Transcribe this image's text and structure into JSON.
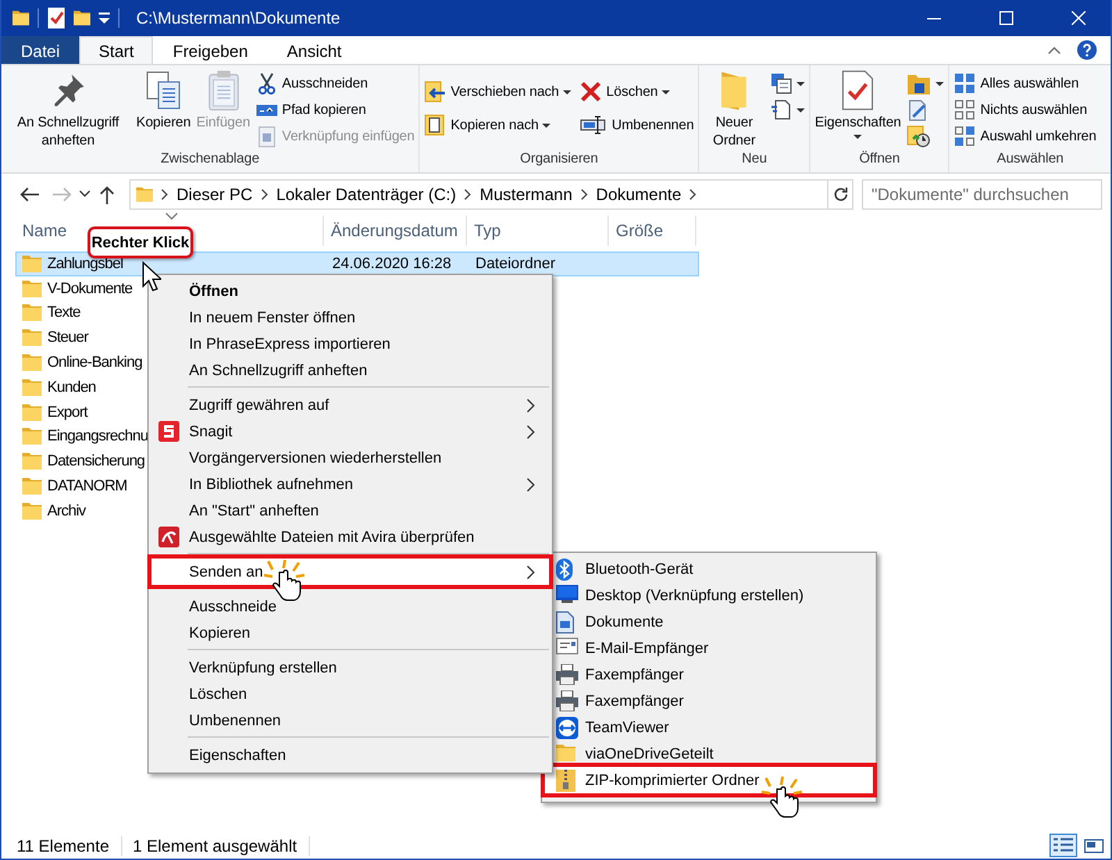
{
  "window": {
    "title": "C:\\Mustermann\\Dokumente"
  },
  "ribbon_tabs": [
    {
      "label": "Datei",
      "kind": "file",
      "selected": false
    },
    {
      "label": "Start",
      "kind": "tab",
      "selected": true
    },
    {
      "label": "Freigeben",
      "kind": "tab",
      "selected": false
    },
    {
      "label": "Ansicht",
      "kind": "tab",
      "selected": false
    }
  ],
  "ribbon_groups": [
    {
      "label": "Zwischenablage",
      "large": [
        {
          "label": "An Schnellzugriff anheften",
          "disabled": false,
          "dropdown": false
        },
        {
          "label": "Kopieren",
          "disabled": false,
          "dropdown": false
        },
        {
          "label": "Einfügen",
          "disabled": true,
          "dropdown": false
        }
      ],
      "small": [
        [
          {
            "kind": "text",
            "label": "Ausschneiden",
            "disabled": false,
            "dropdown": false
          },
          {
            "kind": "text",
            "label": "Pfad kopieren",
            "disabled": false,
            "dropdown": false
          },
          {
            "kind": "text",
            "label": "Verknüpfung einfügen",
            "disabled": true,
            "dropdown": false
          }
        ]
      ]
    },
    {
      "label": "Organisieren",
      "small": [
        [
          {
            "kind": "text",
            "label": "Verschieben nach",
            "disabled": false,
            "dropdown": true
          },
          {
            "kind": "text",
            "label": "Kopieren nach",
            "disabled": false,
            "dropdown": true
          }
        ],
        [
          {
            "kind": "text",
            "label": "Löschen",
            "disabled": false,
            "dropdown": true
          },
          {
            "kind": "text",
            "label": "Umbenennen",
            "disabled": false,
            "dropdown": false
          }
        ]
      ]
    },
    {
      "label": "Neu",
      "large": [
        {
          "label": "Neuer Ordner",
          "disabled": false,
          "dropdown": false
        }
      ],
      "small": [
        [
          {
            "kind": "icon",
            "disabled": false,
            "dropdown": true
          },
          {
            "kind": "icon",
            "disabled": false,
            "dropdown": true
          }
        ]
      ]
    },
    {
      "label": "Öffnen",
      "large": [
        {
          "label": "Eigenschaften",
          "disabled": false,
          "dropdown": true
        }
      ],
      "small": [
        [
          {
            "kind": "icon",
            "disabled": false,
            "dropdown": true
          },
          {
            "kind": "icon",
            "disabled": false,
            "dropdown": false
          },
          {
            "kind": "icon",
            "disabled": false,
            "dropdown": false
          }
        ]
      ]
    },
    {
      "label": "Auswählen",
      "small": [
        [
          {
            "kind": "text",
            "label": "Alles auswählen",
            "disabled": false,
            "dropdown": false
          },
          {
            "kind": "text",
            "label": "Nichts auswählen",
            "disabled": false,
            "dropdown": false
          },
          {
            "kind": "text",
            "label": "Auswahl umkehren",
            "disabled": false,
            "dropdown": false
          }
        ]
      ]
    }
  ],
  "breadcrumb": [
    "Dieser PC",
    "Lokaler Datenträger (C:)",
    "Mustermann",
    "Dokumente"
  ],
  "search": {
    "placeholder": "\"Dokumente\" durchsuchen"
  },
  "columns": [
    "Name",
    "Änderungsdatum",
    "Typ",
    "Größe"
  ],
  "rows": [
    {
      "name": "Zahlungsbel",
      "date": "24.06.2020 16:28",
      "type": "Dateiordner",
      "selected": true
    },
    {
      "name": "V-Dokumente",
      "selected": false
    },
    {
      "name": "Texte",
      "selected": false
    },
    {
      "name": "Steuer",
      "selected": false
    },
    {
      "name": "Online-Banking",
      "selected": false
    },
    {
      "name": "Kunden",
      "selected": false
    },
    {
      "name": "Export",
      "selected": false
    },
    {
      "name": "Eingangsrechnu",
      "selected": false
    },
    {
      "name": "Datensicherung",
      "selected": false
    },
    {
      "name": "DATANORM",
      "selected": false
    },
    {
      "name": "Archiv",
      "selected": false
    }
  ],
  "callout": "Rechter Klick",
  "context_menu": [
    {
      "kind": "default",
      "label": "Öffnen",
      "submenu": false,
      "selected": false
    },
    {
      "kind": "item",
      "label": "In neuem Fenster öffnen",
      "submenu": false,
      "selected": false
    },
    {
      "kind": "item",
      "label": "In PhraseExpress importieren",
      "submenu": false,
      "selected": false
    },
    {
      "kind": "item",
      "label": "An Schnellzugriff anheften",
      "submenu": false,
      "selected": false
    },
    {
      "kind": "separator"
    },
    {
      "kind": "item",
      "label": "Zugriff gewähren auf",
      "submenu": true,
      "selected": false
    },
    {
      "kind": "item",
      "label": "Snagit",
      "submenu": true,
      "selected": false
    },
    {
      "kind": "item",
      "label": "Vorgängerversionen wiederherstellen",
      "submenu": false,
      "selected": false
    },
    {
      "kind": "item",
      "label": "In Bibliothek aufnehmen",
      "submenu": true,
      "selected": false
    },
    {
      "kind": "item",
      "label": "An \"Start\" anheften",
      "submenu": false,
      "selected": false
    },
    {
      "kind": "item",
      "label": "Ausgewählte Dateien mit Avira überprüfen",
      "submenu": false,
      "selected": false
    },
    {
      "kind": "separator"
    },
    {
      "kind": "item",
      "label": "Senden an",
      "submenu": true,
      "selected": true
    },
    {
      "kind": "separator"
    },
    {
      "kind": "item",
      "label": "Ausschneide",
      "submenu": false,
      "selected": false
    },
    {
      "kind": "item",
      "label": "Kopieren",
      "submenu": false,
      "selected": false
    },
    {
      "kind": "separator"
    },
    {
      "kind": "item",
      "label": "Verknüpfung erstellen",
      "submenu": false,
      "selected": false
    },
    {
      "kind": "item",
      "label": "Löschen",
      "submenu": false,
      "selected": false
    },
    {
      "kind": "item",
      "label": "Umbenennen",
      "submenu": false,
      "selected": false
    },
    {
      "kind": "separator"
    },
    {
      "kind": "item",
      "label": "Eigenschaften",
      "submenu": false,
      "selected": false
    }
  ],
  "send_to_menu": [
    {
      "label": "Bluetooth-Gerät",
      "selected": false
    },
    {
      "label": "Desktop (Verknüpfung erstellen)",
      "selected": false
    },
    {
      "label": "Dokumente",
      "selected": false
    },
    {
      "label": "E-Mail-Empfänger",
      "selected": false
    },
    {
      "label": "Faxempfänger",
      "selected": false
    },
    {
      "label": "Faxempfänger",
      "selected": false
    },
    {
      "label": "TeamViewer",
      "selected": false
    },
    {
      "label": "viaOneDriveGeteilt",
      "selected": false
    },
    {
      "label": "ZIP-komprimierter Ordner",
      "selected": true
    }
  ],
  "status_bar": {
    "count": "11 Elemente",
    "selection": "1 Element ausgewählt",
    "views": [
      {
        "selected": true
      },
      {
        "selected": false
      }
    ]
  }
}
